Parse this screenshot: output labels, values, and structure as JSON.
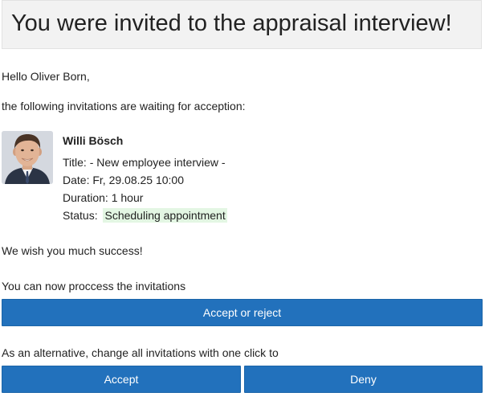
{
  "header": {
    "title": "You were invited to the appraisal interview!"
  },
  "greeting": "Hello Oliver Born,",
  "intro": "the following invitations are waiting for acception:",
  "invitation": {
    "name": "Willi Bösch",
    "title_label": "Title:",
    "title_value": "- New employee interview -",
    "date_label": "Date:",
    "date_value": "Fr, 29.08.25 10:00",
    "duration_label": "Duration:",
    "duration_value": "1 hour",
    "status_label": "Status:",
    "status_value": "Scheduling appointment",
    "status_color": "#e3f6e3"
  },
  "success_text": "We wish you much success!",
  "process_text": "You can now proccess the invitations",
  "accept_or_reject_label": "Accept or reject",
  "alternative_text": "As an alternative, change all invitations with one click to",
  "accept_label": "Accept",
  "deny_label": "Deny",
  "colors": {
    "button": "#2271bc",
    "header_bg": "#f2f2f2"
  }
}
